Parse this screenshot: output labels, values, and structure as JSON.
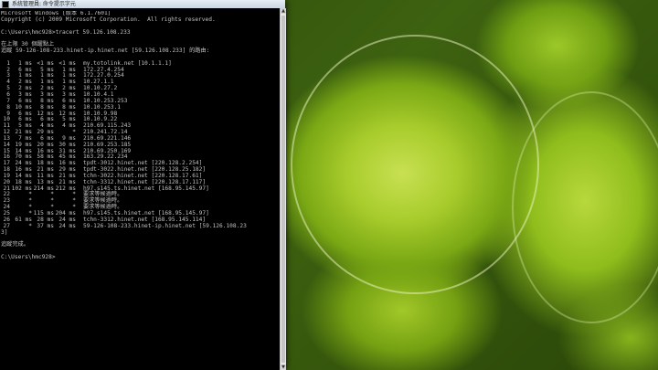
{
  "window": {
    "title": "系統管理員: 命令提示字元",
    "icon": "cmd-icon"
  },
  "console": {
    "header_lines": [
      "Microsoft Windows [版本 6.1.7601]",
      "Copyright (c) 2009 Microsoft Corporation.  All rights reserved.",
      "",
      "C:\\Users\\hmc928>tracert 59.126.108.233",
      "",
      "在上限 30 個躍點上",
      "追蹤 59-126-108-233.hinet-ip.hinet.net [59.126.108.233] 的路由:",
      ""
    ],
    "hops": [
      {
        "n": "1",
        "t1": "1 ms",
        "t2": "<1 ms",
        "t3": "<1 ms",
        "host": "my.totolink.net [10.1.1.1]"
      },
      {
        "n": "2",
        "t1": "6 ms",
        "t2": "5 ms",
        "t3": "1 ms",
        "host": "172.27.4.254"
      },
      {
        "n": "3",
        "t1": "1 ms",
        "t2": "1 ms",
        "t3": "1 ms",
        "host": "172.27.0.254"
      },
      {
        "n": "4",
        "t1": "2 ms",
        "t2": "1 ms",
        "t3": "1 ms",
        "host": "10.27.1.1"
      },
      {
        "n": "5",
        "t1": "2 ms",
        "t2": "2 ms",
        "t3": "2 ms",
        "host": "10.10.27.2"
      },
      {
        "n": "6",
        "t1": "3 ms",
        "t2": "3 ms",
        "t3": "3 ms",
        "host": "10.10.4.1"
      },
      {
        "n": "7",
        "t1": "6 ms",
        "t2": "8 ms",
        "t3": "6 ms",
        "host": "10.10.253.253"
      },
      {
        "n": "8",
        "t1": "10 ms",
        "t2": "8 ms",
        "t3": "8 ms",
        "host": "10.10.253.1"
      },
      {
        "n": "9",
        "t1": "6 ms",
        "t2": "12 ms",
        "t3": "12 ms",
        "host": "10.10.9.98"
      },
      {
        "n": "10",
        "t1": "6 ms",
        "t2": "6 ms",
        "t3": "5 ms",
        "host": "10.10.9.22"
      },
      {
        "n": "11",
        "t1": "5 ms",
        "t2": "4 ms",
        "t3": "4 ms",
        "host": "210.69.115.243"
      },
      {
        "n": "12",
        "t1": "21 ms",
        "t2": "29 ms",
        "t3": "*",
        "host": "210.241.72.14"
      },
      {
        "n": "13",
        "t1": "7 ms",
        "t2": "6 ms",
        "t3": "9 ms",
        "host": "210.69.221.146"
      },
      {
        "n": "14",
        "t1": "19 ms",
        "t2": "20 ms",
        "t3": "30 ms",
        "host": "210.69.253.185"
      },
      {
        "n": "15",
        "t1": "14 ms",
        "t2": "16 ms",
        "t3": "31 ms",
        "host": "210.69.250.169"
      },
      {
        "n": "16",
        "t1": "70 ms",
        "t2": "58 ms",
        "t3": "45 ms",
        "host": "163.29.22.234"
      },
      {
        "n": "17",
        "t1": "24 ms",
        "t2": "18 ms",
        "t3": "16 ms",
        "host": "tpdt-3012.hinet.net [220.128.2.254]"
      },
      {
        "n": "18",
        "t1": "16 ms",
        "t2": "21 ms",
        "t3": "29 ms",
        "host": "tpdt-3022.hinet.net [220.128.25.182]"
      },
      {
        "n": "19",
        "t1": "14 ms",
        "t2": "11 ms",
        "t3": "21 ms",
        "host": "tchn-3022.hinet.net [220.128.17.61]"
      },
      {
        "n": "20",
        "t1": "18 ms",
        "t2": "13 ms",
        "t3": "21 ms",
        "host": "tchn-3312.hinet.net [220.128.17.117]"
      },
      {
        "n": "21",
        "t1": "102 ms",
        "t2": "214 ms",
        "t3": "212 ms",
        "host": "h97.s145.ts.hinet.net [168.95.145.97]"
      },
      {
        "n": "22",
        "t1": "*",
        "t2": "*",
        "t3": "*",
        "host": "要求等候逾時。"
      },
      {
        "n": "23",
        "t1": "*",
        "t2": "*",
        "t3": "*",
        "host": "要求等候逾時。"
      },
      {
        "n": "24",
        "t1": "*",
        "t2": "*",
        "t3": "*",
        "host": "要求等候逾時。"
      },
      {
        "n": "25",
        "t1": "*",
        "t2": "115 ms",
        "t3": "204 ms",
        "host": "h97.s145.ts.hinet.net [168.95.145.97]"
      },
      {
        "n": "26",
        "t1": "61 ms",
        "t2": "28 ms",
        "t3": "24 ms",
        "host": "tchn-3312.hinet.net [168.95.145.114]"
      },
      {
        "n": "27",
        "t1": "*",
        "t2": "37 ms",
        "t3": "24 ms",
        "host": "59-126-108-233.hinet-ip.hinet.net [59.126.108.23"
      }
    ],
    "wrap_line": "3]",
    "footer_lines": [
      "",
      "追蹤完成。",
      "",
      "C:\\Users\\hmc928>"
    ]
  }
}
